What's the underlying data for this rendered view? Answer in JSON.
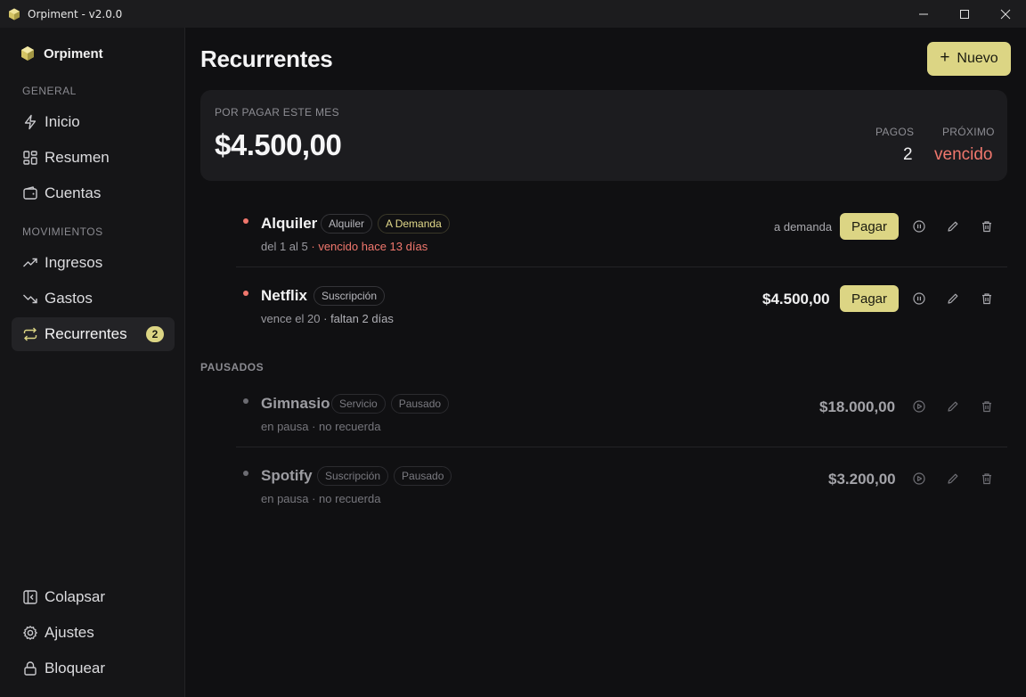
{
  "window": {
    "title": "Orpiment - v2.0.0"
  },
  "sidebar": {
    "brand": "Orpiment",
    "sections": [
      {
        "label": "GENERAL"
      },
      {
        "label": "MOVIMIENTOS"
      }
    ],
    "items": [
      {
        "label": "Inicio",
        "icon": "lightning-icon"
      },
      {
        "label": "Resumen",
        "icon": "grid-icon"
      },
      {
        "label": "Cuentas",
        "icon": "wallet-icon"
      },
      {
        "label": "Ingresos",
        "icon": "trend-up-icon"
      },
      {
        "label": "Gastos",
        "icon": "trend-down-icon"
      },
      {
        "label": "Recurrentes",
        "icon": "repeat-icon",
        "badge": "2",
        "active": true
      }
    ],
    "footer": [
      {
        "label": "Colapsar",
        "icon": "collapse-icon"
      },
      {
        "label": "Ajustes",
        "icon": "gear-icon"
      },
      {
        "label": "Bloquear",
        "icon": "lock-icon"
      }
    ]
  },
  "header": {
    "title": "Recurrentes",
    "new_button": "Nuevo"
  },
  "summary": {
    "label": "POR PAGAR ESTE MES",
    "amount": "$4.500,00",
    "payments_label": "PAGOS",
    "payments_value": "2",
    "next_label": "PRÓXIMO",
    "next_value": "vencido"
  },
  "active": [
    {
      "name": "Alquiler",
      "tags": [
        "Alquiler",
        "A Demanda"
      ],
      "sub_main": "del 1 al 5",
      "sub_extra": "· vencido hace 13 días",
      "right_text": "a demanda",
      "pay_label": "Pagar"
    },
    {
      "name": "Netflix",
      "tags": [
        "Suscripción"
      ],
      "sub_main": "vence el 20",
      "sub_extra": "· faltan 2 días",
      "price": "$4.500,00",
      "pay_label": "Pagar"
    }
  ],
  "paused_label": "PAUSADOS",
  "paused": [
    {
      "name": "Gimnasio",
      "tags": [
        "Servicio",
        "Pausado"
      ],
      "sub": "en pausa · no recuerda",
      "price": "$18.000,00"
    },
    {
      "name": "Spotify",
      "tags": [
        "Suscripción",
        "Pausado"
      ],
      "sub": "en pausa · no recuerda",
      "price": "$3.200,00"
    }
  ],
  "colors": {
    "accent": "#dcd584",
    "danger": "#f0776d",
    "background": "#101012",
    "sidebar": "#151517",
    "card": "#1c1c1f"
  }
}
